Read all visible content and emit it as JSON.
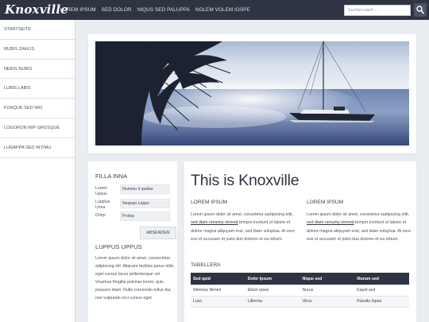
{
  "header": {
    "logo": "Knoxville",
    "nav": [
      "LOREM IPSUM",
      "SED DOLOR",
      "NIQUS SED PALUPPA",
      "NOLEM VOLEM IOSPE"
    ],
    "search_placeholder": "Suchen nach ...",
    "search_icon": "magnifier-icon"
  },
  "sidebar": {
    "items": [
      "STARTSEITE",
      "RUBIS ZAHLIS",
      "NEBIS NUBIS",
      "LUBIS LABIS",
      "FUNQUE SED NIO",
      "LOGORON MIP GROSQUE",
      "LURAPPA SED INTIMU"
    ]
  },
  "hero": {
    "alt": "Sailboat on the sea with palm leaves"
  },
  "filter": {
    "title": "FILLA INNA",
    "fields": [
      {
        "label": "Lorem Upsus",
        "value": "Nummu it quidse"
      },
      {
        "label": "Lupplus Unna",
        "value": "Nequan Loppo"
      },
      {
        "label": "Orlep",
        "value": "Prolep"
      }
    ],
    "submit": "ABSENDEN",
    "section_title": "LUPPUS UPPUS",
    "paragraph": "Lorem ipsum dolor sit amet, consectetur adipiscing elit. Aliquam facilisis purus nibh, eget cursus lacus pellentesque vel. Vivamus fringilla pulvinar lorem, quis posuere diam. Nulla commodo tellus dui, non vulputate orci cursus eget."
  },
  "main": {
    "title": "This is Knoxville",
    "columns": [
      {
        "heading": "LOREM IPSUM",
        "text_before": "Lorem ipsum dolor sit amet, consetetur sadipscing elitr, ",
        "link": "sed diam nonumy eirmod",
        "text_after": " tempor invidunt ut labore et dolore magna aliquyam erat, sed diam voluptua. At vero eos et accusam et justo duo dolores et ea rebum."
      },
      {
        "heading": "LOREM IPSUM",
        "text_before": "Lorem ipsum dolor sit amet, consetetur sadipscing elitr, ",
        "link": "sed diam nonumy eirmod",
        "text_after": " tempor invidunt ut labore et dolore magna aliquyam erat, sed diam voluptua. At vero eos et accusam et justo duo dolores et ea rebum."
      }
    ],
    "table_title": "TABELLERA",
    "table": {
      "headers": [
        "Sed quid",
        "Dolor Ipsum",
        "Nique sed",
        "Illurum sed"
      ],
      "rows": [
        [
          "Nimmus Nimmi",
          "Ellum epsio",
          "Nurus",
          "Equid sed"
        ],
        [
          "Luso",
          "Lillerma",
          "Ulrus",
          "Fukultu lopsa"
        ]
      ]
    }
  }
}
